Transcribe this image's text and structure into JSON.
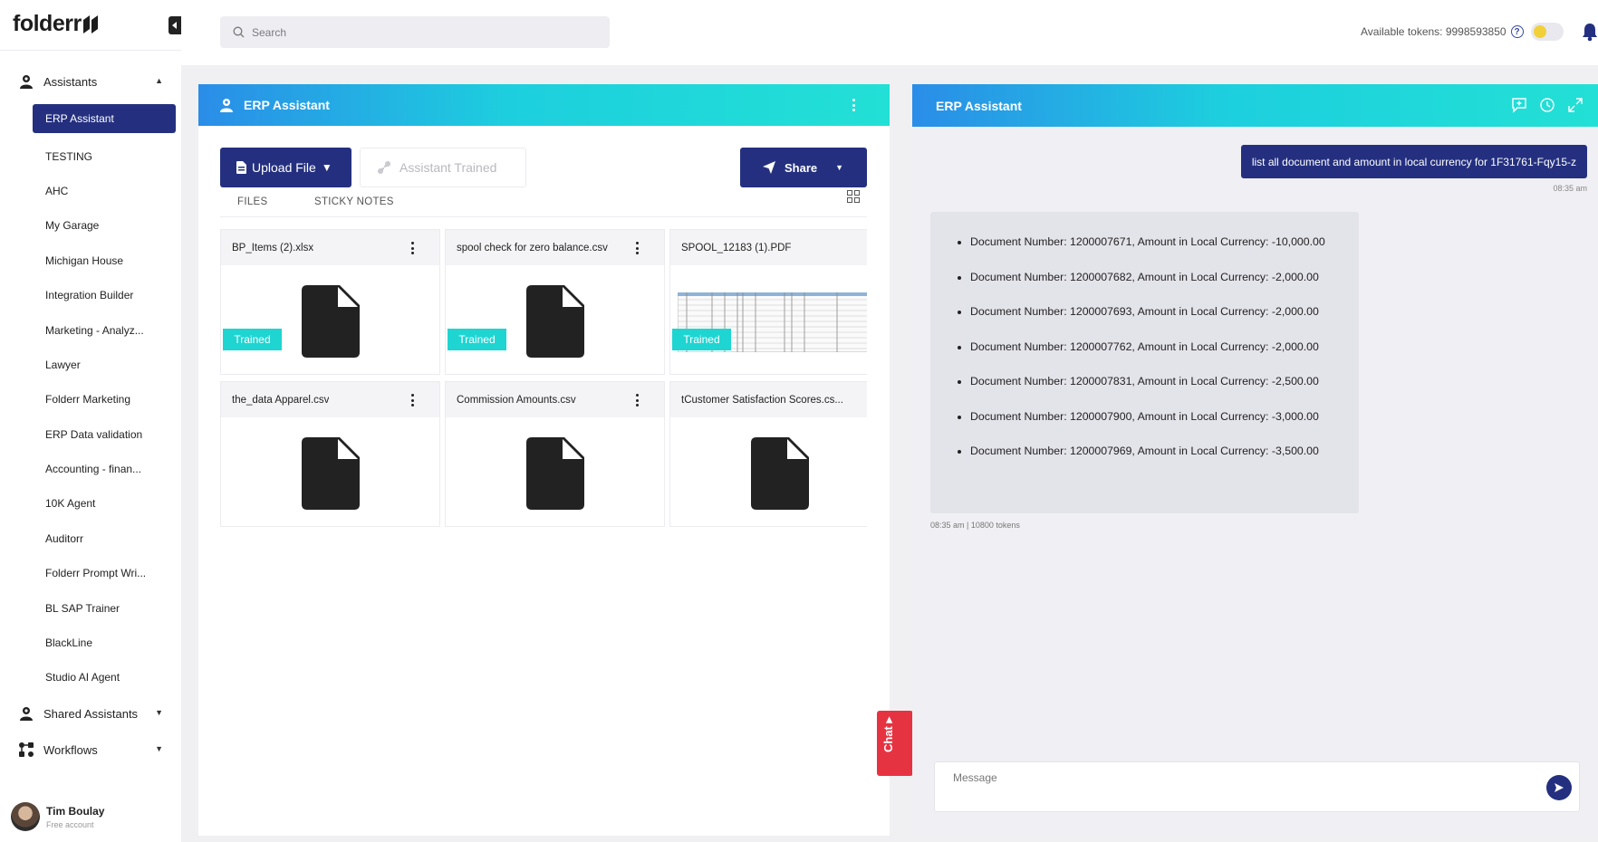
{
  "brand": {
    "logo_text": "folderr"
  },
  "sidebar": {
    "assistants_label": "Assistants",
    "items": [
      {
        "label": "ERP Assistant",
        "active": true
      },
      {
        "label": "TESTING"
      },
      {
        "label": "AHC"
      },
      {
        "label": "My Garage"
      },
      {
        "label": "Michigan House"
      },
      {
        "label": "Integration Builder"
      },
      {
        "label": "Marketing - Analyz..."
      },
      {
        "label": "Lawyer"
      },
      {
        "label": "Folderr Marketing"
      },
      {
        "label": "ERP Data validation"
      },
      {
        "label": "Accounting - finan..."
      },
      {
        "label": "10K Agent"
      },
      {
        "label": "Auditorr"
      },
      {
        "label": "Folderr Prompt Wri..."
      },
      {
        "label": "BL SAP Trainer"
      },
      {
        "label": "BlackLine"
      },
      {
        "label": "Studio AI Agent"
      }
    ],
    "shared_label": "Shared Assistants",
    "workflows_label": "Workflows",
    "user": {
      "name": "Tim Boulay",
      "plan": "Free account"
    }
  },
  "topbar": {
    "search_placeholder": "Search",
    "tokens_label": "Available tokens: 9998593850",
    "help": "?"
  },
  "left_panel": {
    "title": "ERP Assistant",
    "upload_label": "Upload File",
    "trained_label": "Assistant Trained",
    "share_label": "Share",
    "tabs": {
      "files": "FILES",
      "sticky": "STICKY NOTES"
    },
    "files": [
      {
        "name": "BP_Items (2).xlsx",
        "badge": "Trained"
      },
      {
        "name": "spool check for zero balance.csv",
        "badge": "Trained"
      },
      {
        "name": "SPOOL_12183 (1).PDF",
        "badge": "Trained"
      },
      {
        "name": "the_data Apparel.csv"
      },
      {
        "name": "Commission Amounts.csv"
      },
      {
        "name": "tCustomer Satisfaction Scores.cs..."
      }
    ]
  },
  "chat_tab": {
    "label": "Chat"
  },
  "right_panel": {
    "title": "ERP Assistant",
    "user_message": "list all document and amount in local currency for 1F31761-Fqy15-z",
    "user_time": "08:35 am",
    "bot_items": [
      "Document Number: 1200007671, Amount in Local Currency: -10,000.00",
      "Document Number: 1200007682, Amount in Local Currency: -2,000.00",
      "Document Number: 1200007693, Amount in Local Currency: -2,000.00",
      "Document Number: 1200007762, Amount in Local Currency: -2,000.00",
      "Document Number: 1200007831, Amount in Local Currency: -2,500.00",
      "Document Number: 1200007900, Amount in Local Currency: -3,000.00",
      "Document Number: 1200007969, Amount in Local Currency: -3,500.00"
    ],
    "bot_meta": "08:35 am | 10800 tokens",
    "message_placeholder": "Message"
  },
  "colors": {
    "primary": "#24307f",
    "accent": "#1ed5d2",
    "chat_tab": "#e63342"
  }
}
